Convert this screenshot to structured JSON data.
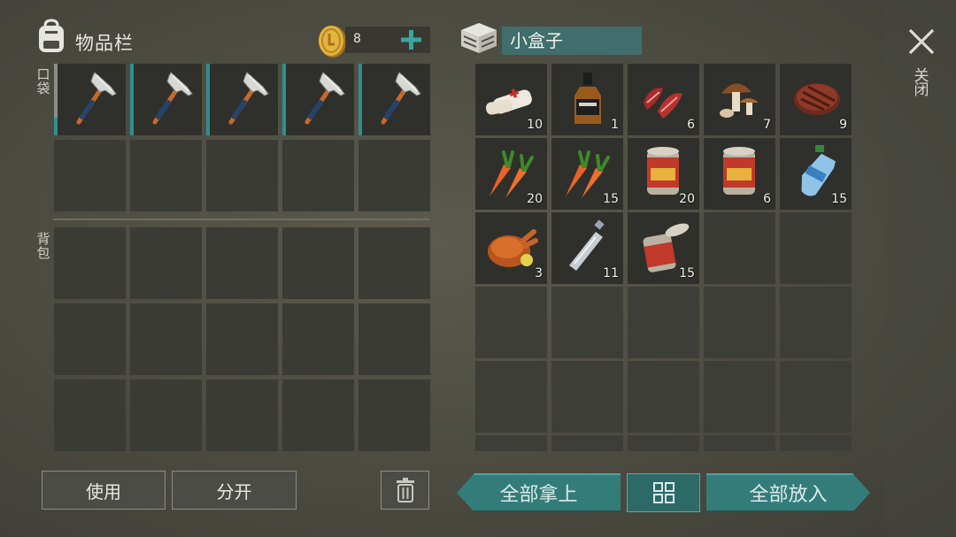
{
  "inventory": {
    "title": "物品栏",
    "coins": "8",
    "pocket_label": "口袋",
    "backpack_label": "背包",
    "pocket_items": [
      {
        "name": "hatchet",
        "durability": 0.25
      },
      {
        "name": "hatchet",
        "durability": 1.0
      },
      {
        "name": "hatchet",
        "durability": 1.0
      },
      {
        "name": "hatchet",
        "durability": 1.0
      },
      {
        "name": "hatchet",
        "durability": 1.0
      }
    ]
  },
  "actions": {
    "use": "使用",
    "split": "分开",
    "trash_icon": "trash-icon"
  },
  "container": {
    "name": "小盒子",
    "items": [
      {
        "icon": "bandage-icon",
        "count": "10"
      },
      {
        "icon": "whiskey-icon",
        "count": "1"
      },
      {
        "icon": "raw-meat-icon",
        "count": "6"
      },
      {
        "icon": "mushroom-icon",
        "count": "7"
      },
      {
        "icon": "steak-icon",
        "count": "9"
      },
      {
        "icon": "carrot-icon",
        "count": "20"
      },
      {
        "icon": "carrot-icon",
        "count": "15"
      },
      {
        "icon": "canned-food-icon",
        "count": "20"
      },
      {
        "icon": "canned-food-icon",
        "count": "6"
      },
      {
        "icon": "water-bottle-icon",
        "count": "15"
      },
      {
        "icon": "roast-chicken-icon",
        "count": "3"
      },
      {
        "icon": "empty-bottle-icon",
        "count": "11"
      },
      {
        "icon": "opened-can-icon",
        "count": "15"
      }
    ],
    "take_all": "全部拿上",
    "put_all": "全部放入",
    "sort_icon": "grid-sort-icon"
  },
  "close_label": "关闭",
  "colors": {
    "accent": "#347c7a",
    "slot": "#3a3b35",
    "durability": "#2f8f8d"
  }
}
